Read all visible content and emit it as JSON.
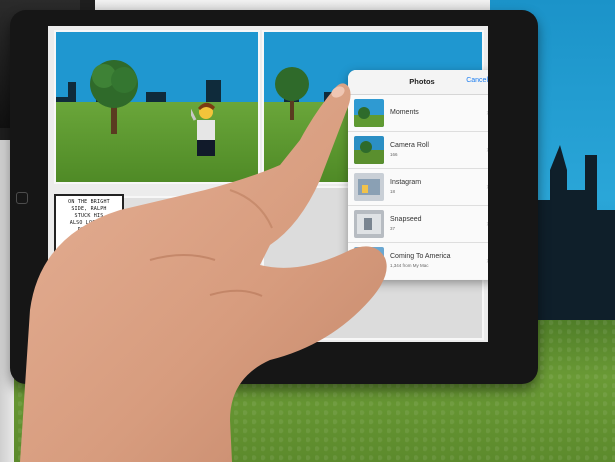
{
  "popover": {
    "title": "Photos",
    "cancel_label": "Cancel",
    "albums": [
      {
        "name": "Moments",
        "count": ""
      },
      {
        "name": "Camera Roll",
        "count": "166"
      },
      {
        "name": "Instagram",
        "count": "18"
      },
      {
        "name": "Snapseed",
        "count": "37"
      },
      {
        "name": "Coming To America",
        "count": "1,344 from My Mac"
      }
    ]
  },
  "comic": {
    "caption_lines": [
      "ON THE BRIGHT",
      "SIDE, RALPH",
      "STUCK HIS",
      "ALSO LOOKING",
      "RIPE..."
    ]
  },
  "colors": {
    "accent": "#1a7cf0",
    "comic_sky": "#1f97d0",
    "grass": "#6a9a35",
    "skin": "#d9a184"
  }
}
